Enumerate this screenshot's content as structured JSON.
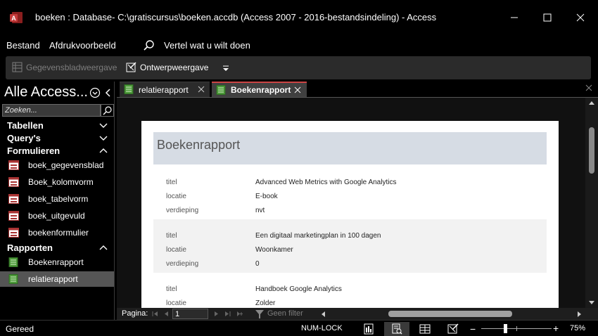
{
  "window": {
    "title": "boeken : Database- C:\\gratiscursus\\boeken.accdb (Access 2007 - 2016-bestandsindeling)  -  Access"
  },
  "menu": {
    "bestand": "Bestand",
    "afdrukvoorbeeld": "Afdrukvoorbeeld",
    "vertel": "Vertel wat u wilt doen"
  },
  "ribbon": {
    "gegevensbladweergave": "Gegevensbladweergave",
    "ontwerpweergave": "Ontwerpweergave"
  },
  "nav": {
    "header": "Alle Access...",
    "search_placeholder": "Zoeken...",
    "groups": {
      "tabellen": "Tabellen",
      "queries": "Query's",
      "formulieren": "Formulieren",
      "rapporten": "Rapporten"
    },
    "forms": [
      "boek_gegevensblad",
      "Boek_kolomvorm",
      "boek_tabelvorm",
      "boek_uitgevuld",
      "boekenformulier"
    ],
    "reports": [
      "Boekenrapport",
      "relatierapport"
    ]
  },
  "tabs": {
    "tab1": "relatierapport",
    "tab2": "Boekenrapport"
  },
  "report": {
    "title": "Boekenrapport",
    "labels": {
      "titel": "titel",
      "locatie": "locatie",
      "verdieping": "verdieping"
    },
    "records": [
      {
        "titel": "Advanced Web Metrics with Google Analytics",
        "locatie": "E-book",
        "verdieping": "nvt"
      },
      {
        "titel": "Een digitaal marketingplan in 100 dagen",
        "locatie": "Woonkamer",
        "verdieping": "0"
      },
      {
        "titel": "Handboek Google Analytics",
        "locatie": "Zolder",
        "verdieping": ""
      }
    ]
  },
  "recordnav": {
    "pagina_label": "Pagina:",
    "page_value": "1",
    "filter_label": "Geen filter"
  },
  "status": {
    "ready": "Gereed",
    "numlock": "NUM-LOCK",
    "zoom_percent": "75%",
    "zoom_level": 0.32
  },
  "colors": {
    "accent": "#c44444",
    "report_header": "#d6dce4",
    "selected_nav": "#555555"
  }
}
